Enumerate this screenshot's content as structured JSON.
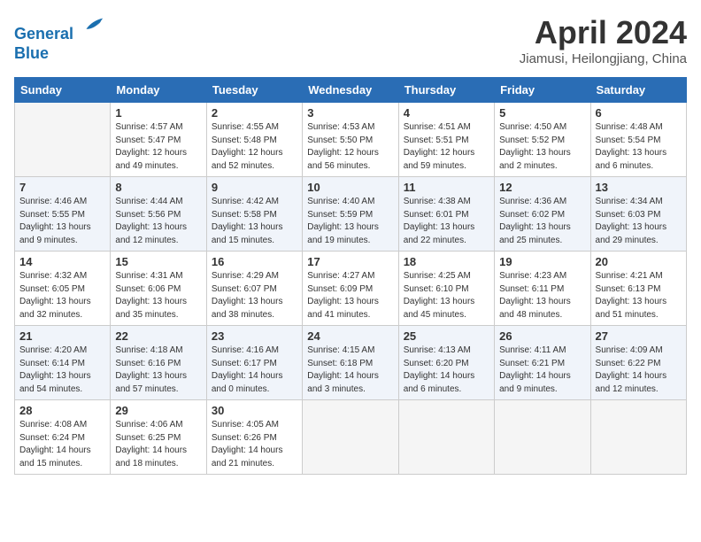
{
  "header": {
    "logo_line1": "General",
    "logo_line2": "Blue",
    "month_title": "April 2024",
    "location": "Jiamusi, Heilongjiang, China"
  },
  "days_of_week": [
    "Sunday",
    "Monday",
    "Tuesday",
    "Wednesday",
    "Thursday",
    "Friday",
    "Saturday"
  ],
  "weeks": [
    [
      {
        "num": "",
        "sunrise": "",
        "sunset": "",
        "daylight": "",
        "empty": true
      },
      {
        "num": "1",
        "sunrise": "Sunrise: 4:57 AM",
        "sunset": "Sunset: 5:47 PM",
        "daylight": "Daylight: 12 hours and 49 minutes."
      },
      {
        "num": "2",
        "sunrise": "Sunrise: 4:55 AM",
        "sunset": "Sunset: 5:48 PM",
        "daylight": "Daylight: 12 hours and 52 minutes."
      },
      {
        "num": "3",
        "sunrise": "Sunrise: 4:53 AM",
        "sunset": "Sunset: 5:50 PM",
        "daylight": "Daylight: 12 hours and 56 minutes."
      },
      {
        "num": "4",
        "sunrise": "Sunrise: 4:51 AM",
        "sunset": "Sunset: 5:51 PM",
        "daylight": "Daylight: 12 hours and 59 minutes."
      },
      {
        "num": "5",
        "sunrise": "Sunrise: 4:50 AM",
        "sunset": "Sunset: 5:52 PM",
        "daylight": "Daylight: 13 hours and 2 minutes."
      },
      {
        "num": "6",
        "sunrise": "Sunrise: 4:48 AM",
        "sunset": "Sunset: 5:54 PM",
        "daylight": "Daylight: 13 hours and 6 minutes."
      }
    ],
    [
      {
        "num": "7",
        "sunrise": "Sunrise: 4:46 AM",
        "sunset": "Sunset: 5:55 PM",
        "daylight": "Daylight: 13 hours and 9 minutes."
      },
      {
        "num": "8",
        "sunrise": "Sunrise: 4:44 AM",
        "sunset": "Sunset: 5:56 PM",
        "daylight": "Daylight: 13 hours and 12 minutes."
      },
      {
        "num": "9",
        "sunrise": "Sunrise: 4:42 AM",
        "sunset": "Sunset: 5:58 PM",
        "daylight": "Daylight: 13 hours and 15 minutes."
      },
      {
        "num": "10",
        "sunrise": "Sunrise: 4:40 AM",
        "sunset": "Sunset: 5:59 PM",
        "daylight": "Daylight: 13 hours and 19 minutes."
      },
      {
        "num": "11",
        "sunrise": "Sunrise: 4:38 AM",
        "sunset": "Sunset: 6:01 PM",
        "daylight": "Daylight: 13 hours and 22 minutes."
      },
      {
        "num": "12",
        "sunrise": "Sunrise: 4:36 AM",
        "sunset": "Sunset: 6:02 PM",
        "daylight": "Daylight: 13 hours and 25 minutes."
      },
      {
        "num": "13",
        "sunrise": "Sunrise: 4:34 AM",
        "sunset": "Sunset: 6:03 PM",
        "daylight": "Daylight: 13 hours and 29 minutes."
      }
    ],
    [
      {
        "num": "14",
        "sunrise": "Sunrise: 4:32 AM",
        "sunset": "Sunset: 6:05 PM",
        "daylight": "Daylight: 13 hours and 32 minutes."
      },
      {
        "num": "15",
        "sunrise": "Sunrise: 4:31 AM",
        "sunset": "Sunset: 6:06 PM",
        "daylight": "Daylight: 13 hours and 35 minutes."
      },
      {
        "num": "16",
        "sunrise": "Sunrise: 4:29 AM",
        "sunset": "Sunset: 6:07 PM",
        "daylight": "Daylight: 13 hours and 38 minutes."
      },
      {
        "num": "17",
        "sunrise": "Sunrise: 4:27 AM",
        "sunset": "Sunset: 6:09 PM",
        "daylight": "Daylight: 13 hours and 41 minutes."
      },
      {
        "num": "18",
        "sunrise": "Sunrise: 4:25 AM",
        "sunset": "Sunset: 6:10 PM",
        "daylight": "Daylight: 13 hours and 45 minutes."
      },
      {
        "num": "19",
        "sunrise": "Sunrise: 4:23 AM",
        "sunset": "Sunset: 6:11 PM",
        "daylight": "Daylight: 13 hours and 48 minutes."
      },
      {
        "num": "20",
        "sunrise": "Sunrise: 4:21 AM",
        "sunset": "Sunset: 6:13 PM",
        "daylight": "Daylight: 13 hours and 51 minutes."
      }
    ],
    [
      {
        "num": "21",
        "sunrise": "Sunrise: 4:20 AM",
        "sunset": "Sunset: 6:14 PM",
        "daylight": "Daylight: 13 hours and 54 minutes."
      },
      {
        "num": "22",
        "sunrise": "Sunrise: 4:18 AM",
        "sunset": "Sunset: 6:16 PM",
        "daylight": "Daylight: 13 hours and 57 minutes."
      },
      {
        "num": "23",
        "sunrise": "Sunrise: 4:16 AM",
        "sunset": "Sunset: 6:17 PM",
        "daylight": "Daylight: 14 hours and 0 minutes."
      },
      {
        "num": "24",
        "sunrise": "Sunrise: 4:15 AM",
        "sunset": "Sunset: 6:18 PM",
        "daylight": "Daylight: 14 hours and 3 minutes."
      },
      {
        "num": "25",
        "sunrise": "Sunrise: 4:13 AM",
        "sunset": "Sunset: 6:20 PM",
        "daylight": "Daylight: 14 hours and 6 minutes."
      },
      {
        "num": "26",
        "sunrise": "Sunrise: 4:11 AM",
        "sunset": "Sunset: 6:21 PM",
        "daylight": "Daylight: 14 hours and 9 minutes."
      },
      {
        "num": "27",
        "sunrise": "Sunrise: 4:09 AM",
        "sunset": "Sunset: 6:22 PM",
        "daylight": "Daylight: 14 hours and 12 minutes."
      }
    ],
    [
      {
        "num": "28",
        "sunrise": "Sunrise: 4:08 AM",
        "sunset": "Sunset: 6:24 PM",
        "daylight": "Daylight: 14 hours and 15 minutes."
      },
      {
        "num": "29",
        "sunrise": "Sunrise: 4:06 AM",
        "sunset": "Sunset: 6:25 PM",
        "daylight": "Daylight: 14 hours and 18 minutes."
      },
      {
        "num": "30",
        "sunrise": "Sunrise: 4:05 AM",
        "sunset": "Sunset: 6:26 PM",
        "daylight": "Daylight: 14 hours and 21 minutes."
      },
      {
        "num": "",
        "sunrise": "",
        "sunset": "",
        "daylight": "",
        "empty": true
      },
      {
        "num": "",
        "sunrise": "",
        "sunset": "",
        "daylight": "",
        "empty": true
      },
      {
        "num": "",
        "sunrise": "",
        "sunset": "",
        "daylight": "",
        "empty": true
      },
      {
        "num": "",
        "sunrise": "",
        "sunset": "",
        "daylight": "",
        "empty": true
      }
    ]
  ]
}
